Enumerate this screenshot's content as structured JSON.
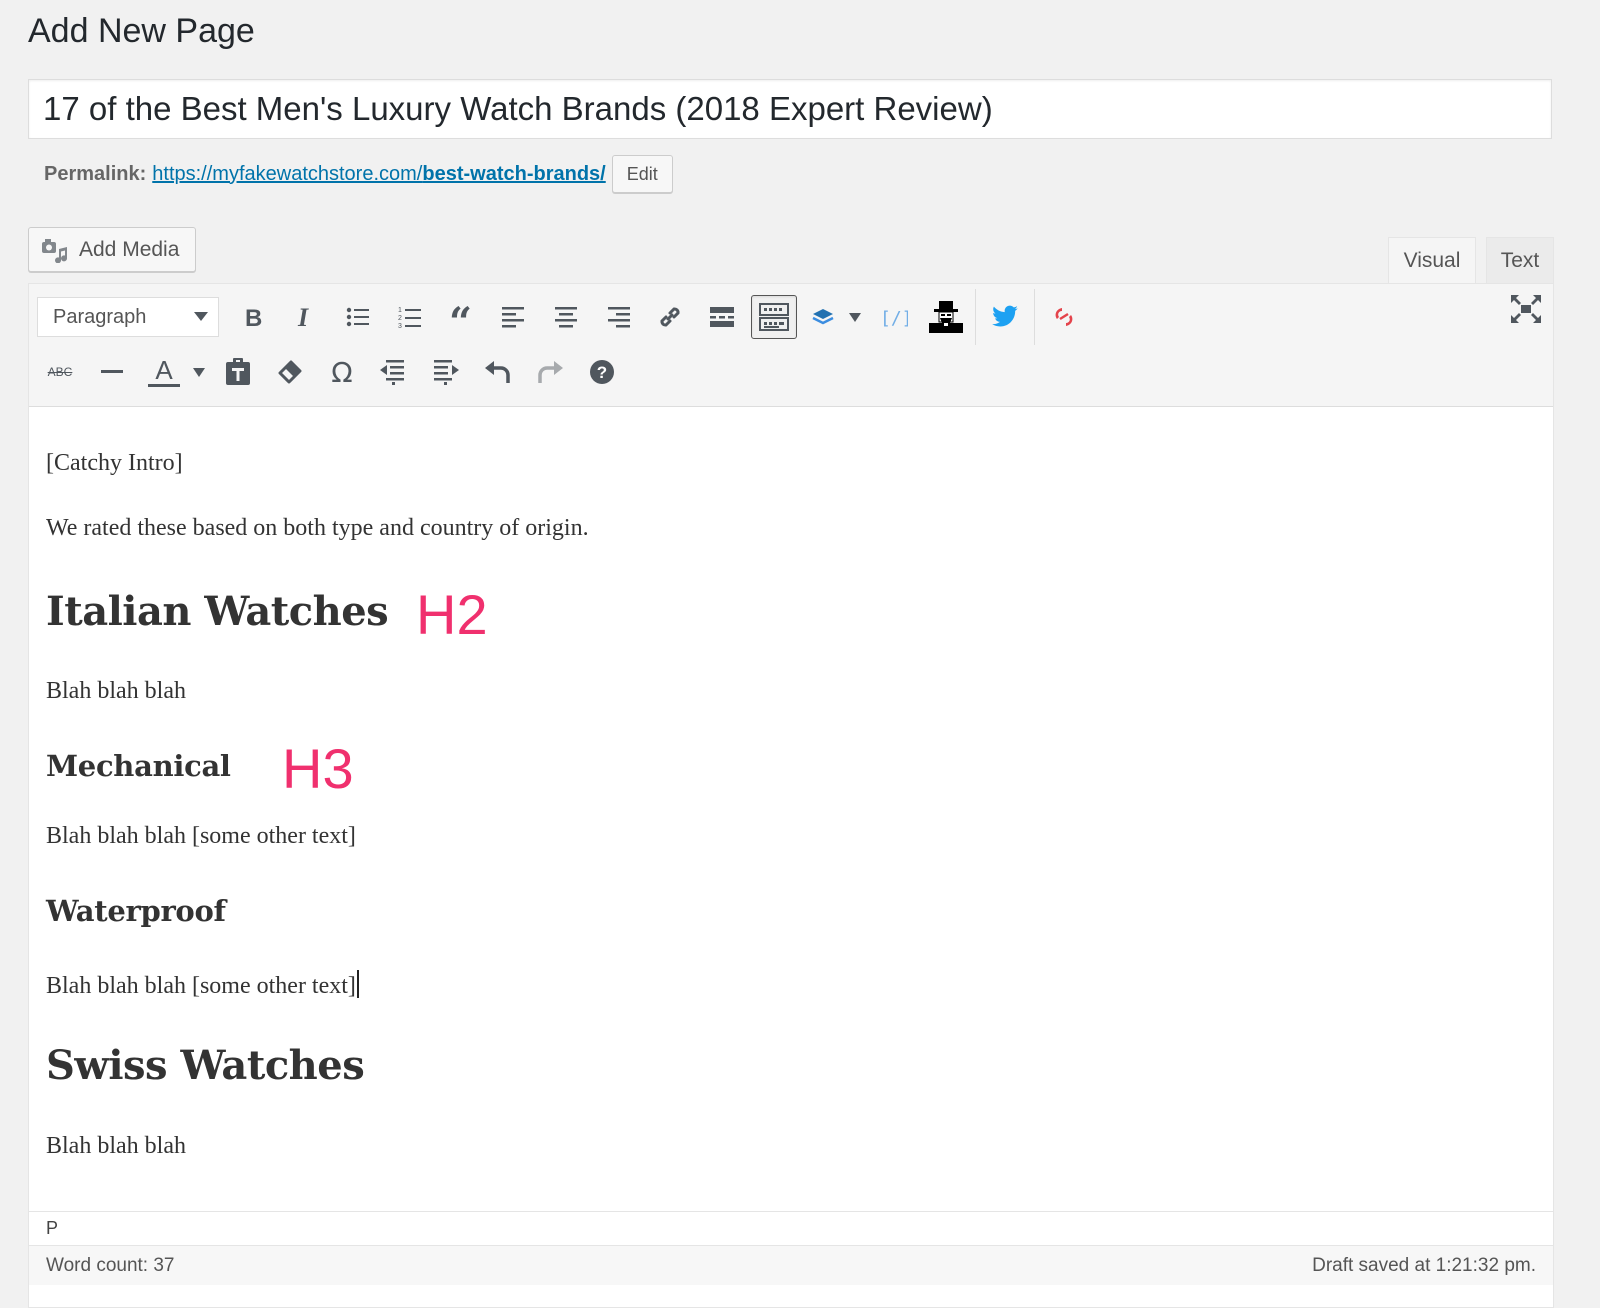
{
  "page": {
    "heading": "Add New Page"
  },
  "post": {
    "title": "17 of the Best Men's Luxury Watch Brands (2018 Expert Review)",
    "permalink_label": "Permalink:",
    "permalink_base": "https://myfakewatchstore.com/",
    "permalink_slug": "best-watch-brands/",
    "edit_label": "Edit"
  },
  "media": {
    "add_media_label": "Add Media"
  },
  "editor_tabs": [
    {
      "label": "Visual",
      "active": true
    },
    {
      "label": "Text",
      "active": false
    }
  ],
  "toolbar": {
    "format_select_value": "Paragraph",
    "row1_icons": [
      "bold-icon",
      "italic-icon",
      "bulleted-list-icon",
      "numbered-list-icon",
      "blockquote-icon",
      "align-left-icon",
      "align-center-icon",
      "align-right-icon",
      "link-icon",
      "read-more-icon",
      "toolbar-toggle-icon",
      "layers-icon",
      "code-icon",
      "spy-icon",
      "twitter-icon",
      "swirl-icon",
      "fullscreen-icon"
    ],
    "row2_icons": [
      "strikethrough-icon",
      "horizontal-line-icon",
      "text-color-icon",
      "paste-as-text-icon",
      "clear-formatting-icon",
      "special-character-icon",
      "outdent-icon",
      "indent-icon",
      "undo-icon",
      "redo-icon",
      "help-icon"
    ],
    "strikethrough_glyph": "ABC",
    "text_color_glyph": "A",
    "special_char_glyph": "Ω",
    "colors": {
      "icon": "#50575e",
      "layers": "#2271b1",
      "code": "#72aee6",
      "twitter": "#1da1f2",
      "swirl": "#e4434b"
    }
  },
  "content": {
    "blocks": [
      {
        "type": "p",
        "text": "[Catchy Intro]"
      },
      {
        "type": "p",
        "text": "We rated these based on both type and country of origin."
      },
      {
        "type": "h2",
        "text": "Italian Watches",
        "annotation": "H2"
      },
      {
        "type": "p",
        "text": "Blah blah blah"
      },
      {
        "type": "h3",
        "text": "Mechanical",
        "annotation": "H3"
      },
      {
        "type": "p",
        "text": "Blah blah blah [some other text]"
      },
      {
        "type": "h3",
        "text": "Waterproof"
      },
      {
        "type": "p",
        "text": "Blah blah blah [some other text]"
      },
      {
        "type": "h2",
        "text": "Swiss Watches"
      },
      {
        "type": "p",
        "text": "Blah blah blah"
      }
    ],
    "annotation_color": "#f0306e"
  },
  "footer": {
    "path": "P",
    "word_count": "Word count: 37",
    "draft_status": "Draft saved at 1:21:32 pm."
  }
}
